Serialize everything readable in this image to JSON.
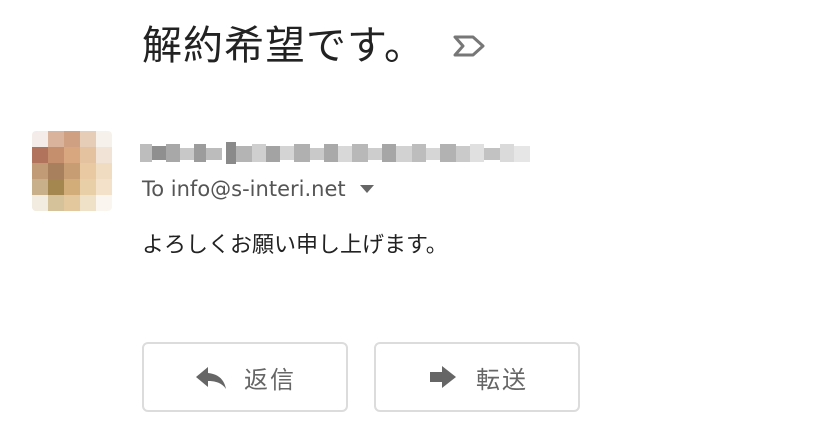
{
  "message": {
    "subject": "解約希望です。",
    "label_icon": "important-marker-icon",
    "sender": {
      "display": "(pixelated sender name and address)",
      "avatar": "pixelated-avatar"
    },
    "recipient_line": "To info@s-interi.net",
    "recipient_dropdown_icon": "caret-down-icon",
    "body": "よろしくお願い申し上げます。"
  },
  "actions": {
    "reply": {
      "label": "返信",
      "icon": "reply-icon"
    },
    "forward": {
      "label": "転送",
      "icon": "forward-icon"
    }
  },
  "colors": {
    "text_primary": "#222222",
    "text_secondary": "#555555",
    "button_border": "#dcdcdc",
    "icon_gray": "#666666"
  }
}
